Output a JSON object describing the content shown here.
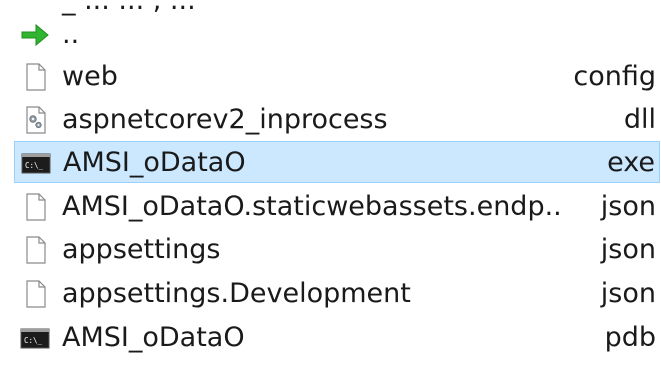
{
  "partial_top_text": "_ ...           ...  ,  ...",
  "rows": [
    {
      "name": "..",
      "ext": "",
      "icon": "green-up-arrow-icon",
      "selected": false
    },
    {
      "name": "web",
      "ext": "config",
      "icon": "generic-file-icon",
      "selected": false
    },
    {
      "name": "aspnetcorev2_inprocess",
      "ext": "dll",
      "icon": "dll-gears-file-icon",
      "selected": false
    },
    {
      "name": "AMSI_oDataO",
      "ext": "exe",
      "icon": "console-app-icon",
      "selected": true
    },
    {
      "name": "AMSI_oDataO.staticwebassets.endp..",
      "ext": "json",
      "icon": "generic-file-icon",
      "selected": false
    },
    {
      "name": "appsettings",
      "ext": "json",
      "icon": "generic-file-icon",
      "selected": false
    },
    {
      "name": "appsettings.Development",
      "ext": "json",
      "icon": "generic-file-icon",
      "selected": false
    },
    {
      "name": "AMSI_oDataO",
      "ext": "pdb",
      "icon": "console-app-icon",
      "selected": false
    }
  ],
  "colors": {
    "selection_bg": "#cce8ff",
    "selection_border": "#99d1ff",
    "arrow_green": "#2fb52f"
  }
}
